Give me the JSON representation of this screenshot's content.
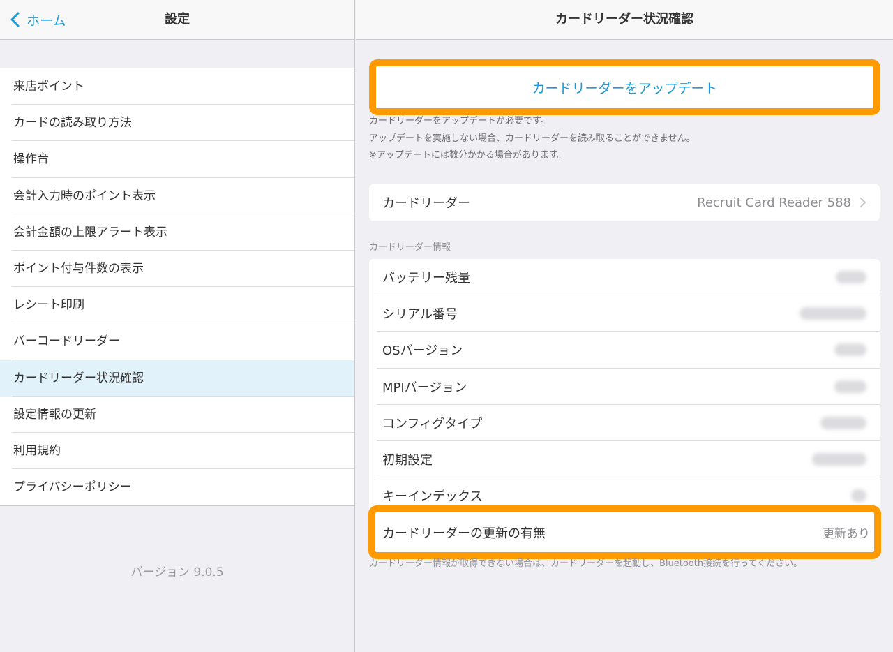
{
  "colors": {
    "accent": "#1a9ad6",
    "highlight": "#ff9a00",
    "selected_bg": "#e1f2fb"
  },
  "left": {
    "back_label": "ホーム",
    "title": "設定",
    "menu": [
      {
        "label": "来店ポイント"
      },
      {
        "label": "カードの読み取り方法"
      },
      {
        "label": "操作音"
      },
      {
        "label": "会計入力時のポイント表示"
      },
      {
        "label": "会計金額の上限アラート表示"
      },
      {
        "label": "ポイント付与件数の表示"
      },
      {
        "label": "レシート印刷"
      },
      {
        "label": "バーコードリーダー"
      },
      {
        "label": "カードリーダー状況確認",
        "selected": true
      },
      {
        "label": "設定情報の更新"
      },
      {
        "label": "利用規約"
      },
      {
        "label": "プライバシーポリシー"
      }
    ],
    "version": "バージョン 9.0.5"
  },
  "right": {
    "title": "カードリーダー状況確認",
    "update_button": "カードリーダーをアップデート",
    "notes": [
      "カードリーダーをアップデートが必要です。",
      "アップデートを実施しない場合、カードリーダーを読み取ることができません。",
      "※アップデートには数分かかる場合があります。"
    ],
    "reader": {
      "label": "カードリーダー",
      "value": "Recruit Card Reader 588"
    },
    "section_title": "カードリーダー情報",
    "info_rows": [
      {
        "label": "バッテリー残量"
      },
      {
        "label": "シリアル番号"
      },
      {
        "label": "OSバージョン"
      },
      {
        "label": "MPIバージョン"
      },
      {
        "label": "コンフィグタイプ"
      },
      {
        "label": "初期設定"
      },
      {
        "label": "キーインデックス"
      }
    ],
    "update_row": {
      "label": "カードリーダーの更新の有無",
      "value": "更新あり"
    },
    "footnote": "カードリーダー情報が取得できない場合は、カードリーダーを起動し、Bluetooth接続を行ってください。"
  }
}
